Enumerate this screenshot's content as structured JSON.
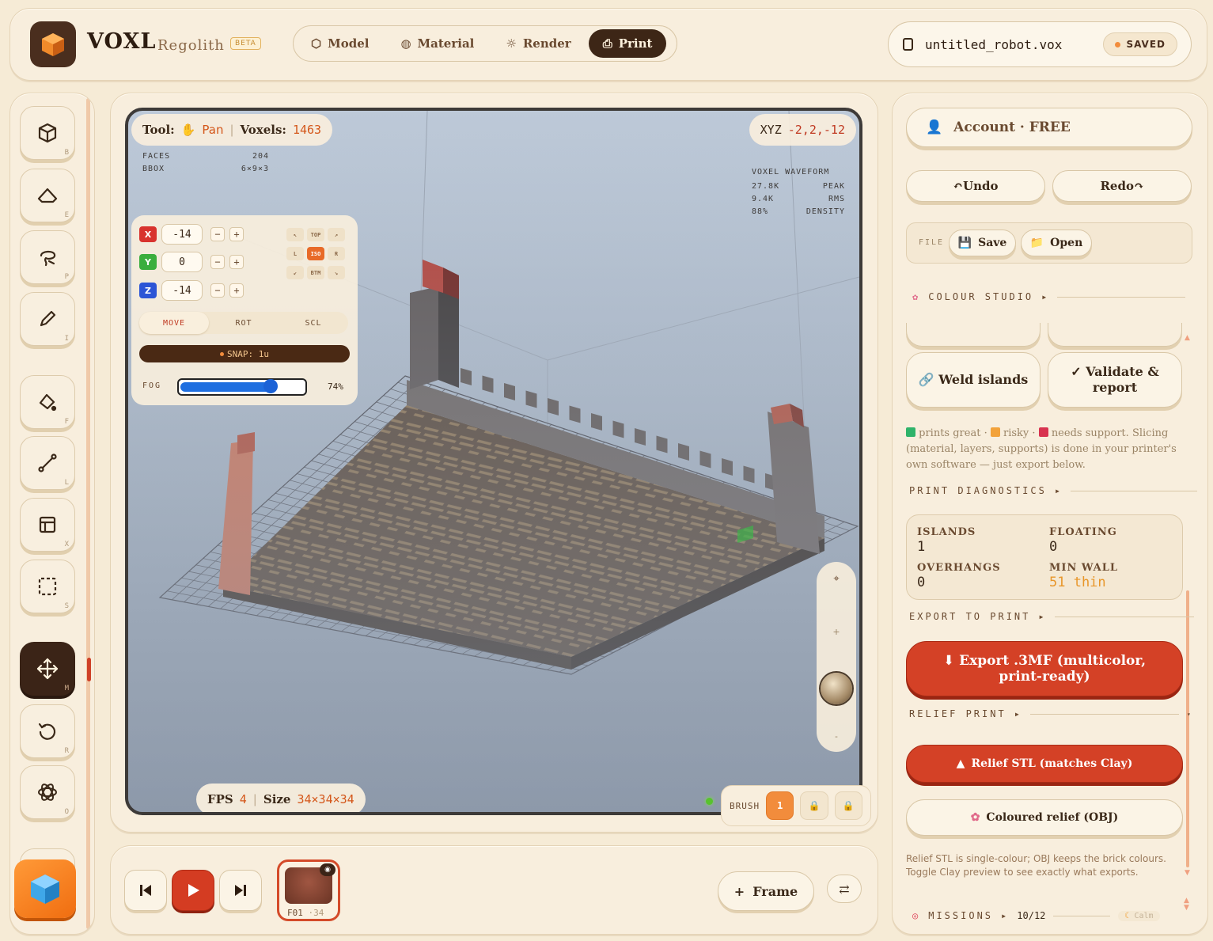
{
  "app": {
    "name": "VOXL",
    "subtitle": "Regolith",
    "badge": "BETA"
  },
  "modes": [
    {
      "label": "Model",
      "icon": "cube-icon",
      "active": false
    },
    {
      "label": "Material",
      "icon": "palette-icon",
      "active": false
    },
    {
      "label": "Render",
      "icon": "sun-icon",
      "active": false
    },
    {
      "label": "Print",
      "icon": "printer-icon",
      "active": true
    }
  ],
  "file": {
    "name": "untitled_robot.vox",
    "status": "SAVED"
  },
  "tools": [
    {
      "name": "block-tool",
      "key": "B",
      "icon": "cube-icon"
    },
    {
      "name": "erase-tool",
      "key": "E",
      "icon": "eraser-icon"
    },
    {
      "name": "paint-tool",
      "key": "P",
      "icon": "lasso-icon"
    },
    {
      "name": "pick-tool",
      "key": "I",
      "icon": "pen-icon"
    },
    {
      "name": "fill-tool",
      "key": "F",
      "icon": "bucket-icon"
    },
    {
      "name": "line-tool",
      "key": "L",
      "icon": "line-icon"
    },
    {
      "name": "box-tool",
      "key": "X",
      "icon": "frame-icon"
    },
    {
      "name": "select-tool",
      "key": "S",
      "icon": "select-icon"
    },
    {
      "name": "move-tool",
      "key": "M",
      "icon": "move-icon",
      "active": true
    },
    {
      "name": "rotate-tool",
      "key": "R",
      "icon": "rotate-icon"
    },
    {
      "name": "orbit-tool",
      "key": "O",
      "icon": "atom-icon"
    }
  ],
  "viewport": {
    "tool_label": "Tool:",
    "tool_value": "Pan",
    "voxels_label": "Voxels:",
    "voxels_value": "1463",
    "xyz_label": "XYZ",
    "xyz_value": "-2,2,-12",
    "faces_label": "FACES",
    "faces_value": "204",
    "bbox_label": "BBOX",
    "bbox_value": "6×9×3",
    "wave_title": "VOXEL WAVEFORM",
    "wave_rows": [
      {
        "value": "27.8K",
        "label": "PEAK"
      },
      {
        "value": "9.4K",
        "label": "RMS"
      },
      {
        "value": "88%",
        "label": "DENSITY"
      }
    ],
    "fps_label": "FPS",
    "fps_value": "4",
    "size_label": "Size",
    "size_value": "34×34×34",
    "brush_label": "BRUSH",
    "brush_slot": "1"
  },
  "gizmo": {
    "x": "-14",
    "y": "0",
    "z": "-14",
    "view_labels": {
      "top": "TOP",
      "left": "L",
      "iso": "ISO",
      "right": "R",
      "bottom": "BTM"
    },
    "modes": [
      "MOVE",
      "ROT",
      "SCL"
    ],
    "snap": "SNAP: 1u",
    "fog_label": "FOG",
    "fog_value": "74%",
    "fog_level": 0.74
  },
  "timeline": {
    "frame_label": "F01",
    "frame_sub": "·34",
    "add_frame": "Frame"
  },
  "right": {
    "account": "Account · FREE",
    "undo": "Undo",
    "redo": "Redo",
    "file_label": "FILE",
    "save": "Save",
    "open": "Open",
    "colour_studio": "COLOUR STUDIO",
    "weld": "Weld islands",
    "validate": "✓ Validate & report",
    "legend_great": "prints great ·",
    "legend_risky": "risky ·",
    "legend_support": "needs support.",
    "slicing_note": "Slicing (material, layers, supports) is done in your printer's own software — just export below.",
    "diag_title": "PRINT DIAGNOSTICS",
    "islands_label": "ISLANDS",
    "islands_value": "1",
    "floating_label": "FLOATING",
    "floating_value": "0",
    "overhangs_label": "OVERHANGS",
    "overhangs_value": "0",
    "minwall_label": "MIN WALL",
    "minwall_value": "51 thin",
    "export_title": "EXPORT TO PRINT",
    "export_3mf": "⬇ Export .3MF (multicolor, print-ready)",
    "relief_title": "RELIEF PRINT",
    "relief_stl": "Relief STL (matches Clay)",
    "coloured_relief": "Coloured relief (OBJ)",
    "relief_note": "Relief STL is single-colour; OBJ keeps the brick colours. Toggle Clay preview to see exactly what exports.",
    "missions_label": "MISSIONS",
    "missions_value": "10/12",
    "calm": "Calm"
  },
  "colors": {
    "accent": "#d44126",
    "dark": "#3b2417",
    "great": "#2fb36a",
    "risky": "#f2a23a",
    "support": "#d8334f"
  }
}
